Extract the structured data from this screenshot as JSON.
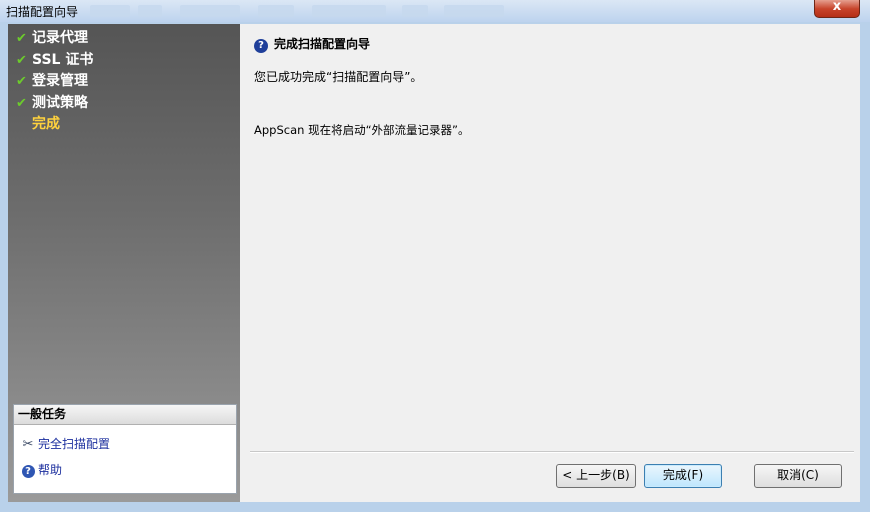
{
  "window": {
    "title": "扫描配置向导",
    "close_label": "x"
  },
  "steps": [
    {
      "label": "记录代理",
      "done": true
    },
    {
      "label": "SSL 证书",
      "done": true
    },
    {
      "label": "登录管理",
      "done": true
    },
    {
      "label": "测试策略",
      "done": true
    },
    {
      "label": "完成",
      "done": false,
      "active": true
    }
  ],
  "check_glyph": "✔",
  "tasks": {
    "header": "一般任务",
    "items": [
      {
        "label": "完全扫描配置",
        "icon": "tools-icon"
      },
      {
        "label": "帮助",
        "icon": "help-icon"
      }
    ]
  },
  "main": {
    "heading": "完成扫描配置向导",
    "help_glyph": "?",
    "para1": "您已成功完成“扫描配置向导”。",
    "para2": "AppScan 现在将启动“外部流量记录器”。"
  },
  "buttons": {
    "back": "< 上一步(B)",
    "finish": "完成(F)",
    "cancel": "取消(C)"
  },
  "colors": {
    "accent_active_step": "#ffd23d",
    "check": "#6ccb2c",
    "link": "#1c2f9e"
  }
}
